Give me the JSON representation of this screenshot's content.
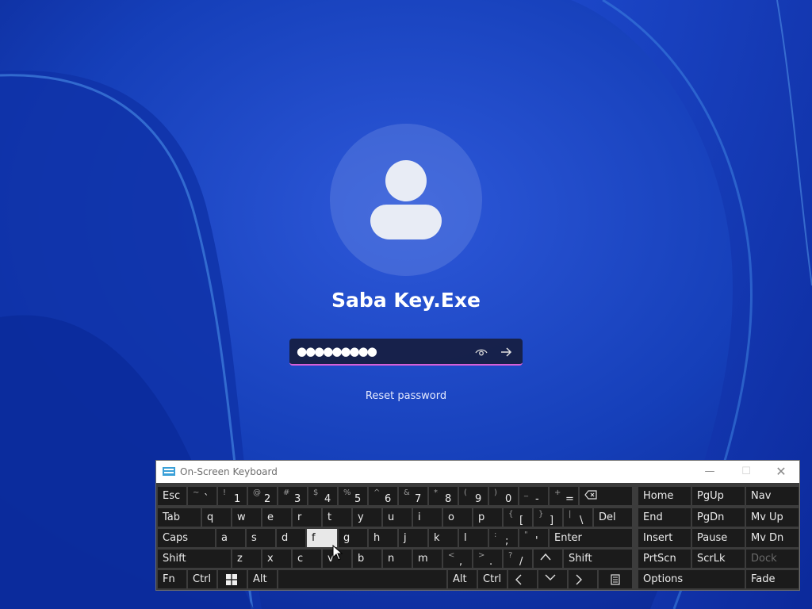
{
  "lock_screen": {
    "user_name": "Saba Key.Exe",
    "password_mask": "●●●●●●●●●",
    "show_password_icon": "eye-icon",
    "submit_icon": "arrow-right-icon",
    "reset_password_label": "Reset password",
    "accent_color": "#d65fd8"
  },
  "osk": {
    "title": "On-Screen Keyboard",
    "controls": {
      "minimize": "—",
      "maximize": "☐",
      "close": "✕"
    },
    "active_key": "f",
    "rows": [
      [
        {
          "label": "Esc"
        },
        {
          "main": "`",
          "sub": "~"
        },
        {
          "main": "1",
          "sub": "!"
        },
        {
          "main": "2",
          "sub": "@"
        },
        {
          "main": "3",
          "sub": "#"
        },
        {
          "main": "4",
          "sub": "$"
        },
        {
          "main": "5",
          "sub": "%"
        },
        {
          "main": "6",
          "sub": "^"
        },
        {
          "main": "7",
          "sub": "&"
        },
        {
          "main": "8",
          "sub": "*"
        },
        {
          "main": "9",
          "sub": "("
        },
        {
          "main": "0",
          "sub": ")"
        },
        {
          "main": "-",
          "sub": "_"
        },
        {
          "main": "=",
          "sub": "+"
        },
        {
          "icon": "backspace-icon"
        }
      ],
      [
        {
          "label": "Tab"
        },
        {
          "label": "q"
        },
        {
          "label": "w"
        },
        {
          "label": "e"
        },
        {
          "label": "r"
        },
        {
          "label": "t"
        },
        {
          "label": "y"
        },
        {
          "label": "u"
        },
        {
          "label": "i"
        },
        {
          "label": "o"
        },
        {
          "label": "p"
        },
        {
          "main": "[",
          "sub": "{"
        },
        {
          "main": "]",
          "sub": "}"
        },
        {
          "main": "\\",
          "sub": "|"
        },
        {
          "label": "Del"
        }
      ],
      [
        {
          "label": "Caps"
        },
        {
          "label": "a"
        },
        {
          "label": "s"
        },
        {
          "label": "d"
        },
        {
          "label": "f"
        },
        {
          "label": "g"
        },
        {
          "label": "h"
        },
        {
          "label": "j"
        },
        {
          "label": "k"
        },
        {
          "label": "l"
        },
        {
          "main": ";",
          "sub": ":"
        },
        {
          "main": "'",
          "sub": "\""
        },
        {
          "label": "Enter"
        }
      ],
      [
        {
          "label": "Shift"
        },
        {
          "label": "z"
        },
        {
          "label": "x"
        },
        {
          "label": "c"
        },
        {
          "label": "v"
        },
        {
          "label": "b"
        },
        {
          "label": "n"
        },
        {
          "label": "m"
        },
        {
          "main": ",",
          "sub": "<"
        },
        {
          "main": ".",
          "sub": ">"
        },
        {
          "main": "/",
          "sub": "?"
        },
        {
          "icon": "arrow-up-icon"
        },
        {
          "label": "Shift"
        }
      ],
      [
        {
          "label": "Fn"
        },
        {
          "label": "Ctrl"
        },
        {
          "icon": "windows-icon"
        },
        {
          "label": "Alt"
        },
        {
          "label": ""
        },
        {
          "label": "Alt"
        },
        {
          "label": "Ctrl"
        },
        {
          "icon": "arrow-left-icon"
        },
        {
          "icon": "arrow-down-icon"
        },
        {
          "icon": "arrow-right-icon"
        },
        {
          "icon": "menu-icon"
        }
      ]
    ],
    "nav_keys": [
      [
        "Home",
        "PgUp",
        "Nav"
      ],
      [
        "End",
        "PgDn",
        "Mv Up"
      ],
      [
        "Insert",
        "Pause",
        "Mv Dn"
      ],
      [
        "PrtScn",
        "ScrLk",
        "Dock"
      ],
      [
        "Options",
        "Fade"
      ]
    ]
  }
}
